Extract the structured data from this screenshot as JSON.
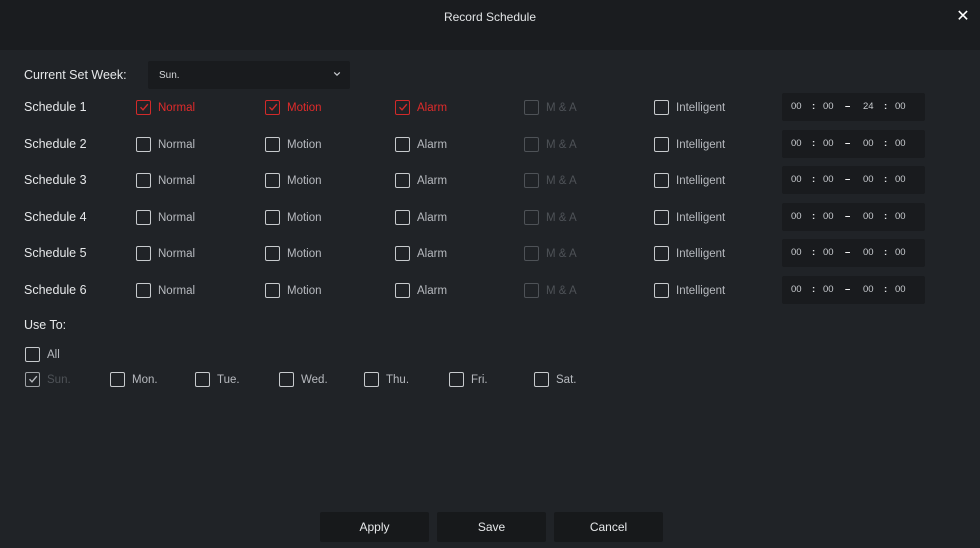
{
  "dialog": {
    "title": "Record Schedule"
  },
  "current_week": {
    "label": "Current Set Week:",
    "value": "Sun."
  },
  "columns": [
    "Normal",
    "Motion",
    "Alarm",
    "M & A",
    "Intelligent"
  ],
  "schedules": [
    {
      "name": "Schedule 1",
      "normal": true,
      "motion": true,
      "alarm": true,
      "ma": false,
      "intelligent": false,
      "start_h": "00",
      "start_m": "00",
      "end_h": "24",
      "end_m": "00"
    },
    {
      "name": "Schedule 2",
      "normal": false,
      "motion": false,
      "alarm": false,
      "ma": false,
      "intelligent": false,
      "start_h": "00",
      "start_m": "00",
      "end_h": "00",
      "end_m": "00"
    },
    {
      "name": "Schedule 3",
      "normal": false,
      "motion": false,
      "alarm": false,
      "ma": false,
      "intelligent": false,
      "start_h": "00",
      "start_m": "00",
      "end_h": "00",
      "end_m": "00"
    },
    {
      "name": "Schedule 4",
      "normal": false,
      "motion": false,
      "alarm": false,
      "ma": false,
      "intelligent": false,
      "start_h": "00",
      "start_m": "00",
      "end_h": "00",
      "end_m": "00"
    },
    {
      "name": "Schedule 5",
      "normal": false,
      "motion": false,
      "alarm": false,
      "ma": false,
      "intelligent": false,
      "start_h": "00",
      "start_m": "00",
      "end_h": "00",
      "end_m": "00"
    },
    {
      "name": "Schedule 6",
      "normal": false,
      "motion": false,
      "alarm": false,
      "ma": false,
      "intelligent": false,
      "start_h": "00",
      "start_m": "00",
      "end_h": "00",
      "end_m": "00"
    }
  ],
  "use_to": {
    "label": "Use To:",
    "all_label": "All",
    "days": [
      {
        "label": "Sun.",
        "checked": true,
        "disabled": true
      },
      {
        "label": "Mon.",
        "checked": false,
        "disabled": false
      },
      {
        "label": "Tue.",
        "checked": false,
        "disabled": false
      },
      {
        "label": "Wed.",
        "checked": false,
        "disabled": false
      },
      {
        "label": "Thu.",
        "checked": false,
        "disabled": false
      },
      {
        "label": "Fri.",
        "checked": false,
        "disabled": false
      },
      {
        "label": "Sat.",
        "checked": false,
        "disabled": false
      }
    ]
  },
  "buttons": {
    "apply": "Apply",
    "save": "Save",
    "cancel": "Cancel"
  },
  "colors": {
    "background": "#202327",
    "accent_red": "#e02b2b",
    "field_bg": "#191b1e"
  },
  "icons": {
    "close": "close-icon",
    "dropdown": "chevron-down-icon",
    "check": "checkmark-icon"
  }
}
